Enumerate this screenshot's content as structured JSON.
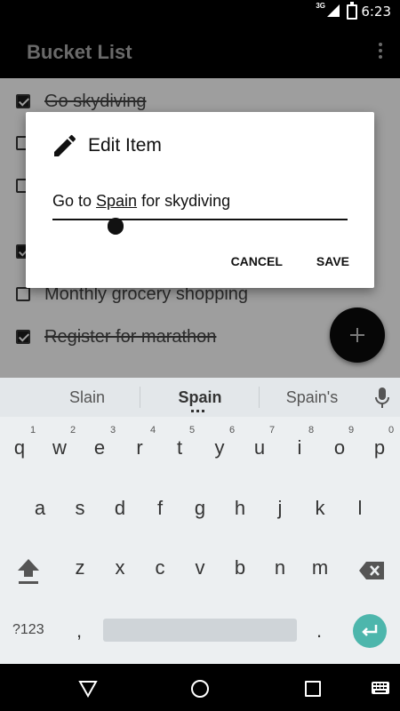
{
  "status_bar": {
    "time": "6:23",
    "network": "3G"
  },
  "app_bar": {
    "title": "Bucket List"
  },
  "list": {
    "items": [
      {
        "label": "Go skydiving",
        "checked": true
      },
      {
        "label": "",
        "checked": false
      },
      {
        "label": "",
        "checked": false
      },
      {
        "label": "",
        "checked": true
      },
      {
        "label": "Monthly grocery shopping",
        "checked": false
      },
      {
        "label": "Register for marathon",
        "checked": true
      }
    ]
  },
  "dialog": {
    "title": "Edit Item",
    "value_before": "Go to ",
    "value_highlight": "Spain",
    "value_after": " for skydiving",
    "cancel_label": "CANCEL",
    "save_label": "SAVE"
  },
  "keyboard": {
    "suggestions": [
      "Slain",
      "Spain",
      "Spain's"
    ],
    "row1": [
      "q",
      "w",
      "e",
      "r",
      "t",
      "y",
      "u",
      "i",
      "o",
      "p"
    ],
    "row1_nums": [
      "1",
      "2",
      "3",
      "4",
      "5",
      "6",
      "7",
      "8",
      "9",
      "0"
    ],
    "row2": [
      "a",
      "s",
      "d",
      "f",
      "g",
      "h",
      "j",
      "k",
      "l"
    ],
    "row3": [
      "z",
      "x",
      "c",
      "v",
      "b",
      "n",
      "m"
    ],
    "symbols_label": "?123",
    "comma_label": ",",
    "period_label": "."
  },
  "colors": {
    "enter_key": "#4db6ac",
    "app_bar": "#000000",
    "dim_overlay": "#9e9e9e"
  }
}
